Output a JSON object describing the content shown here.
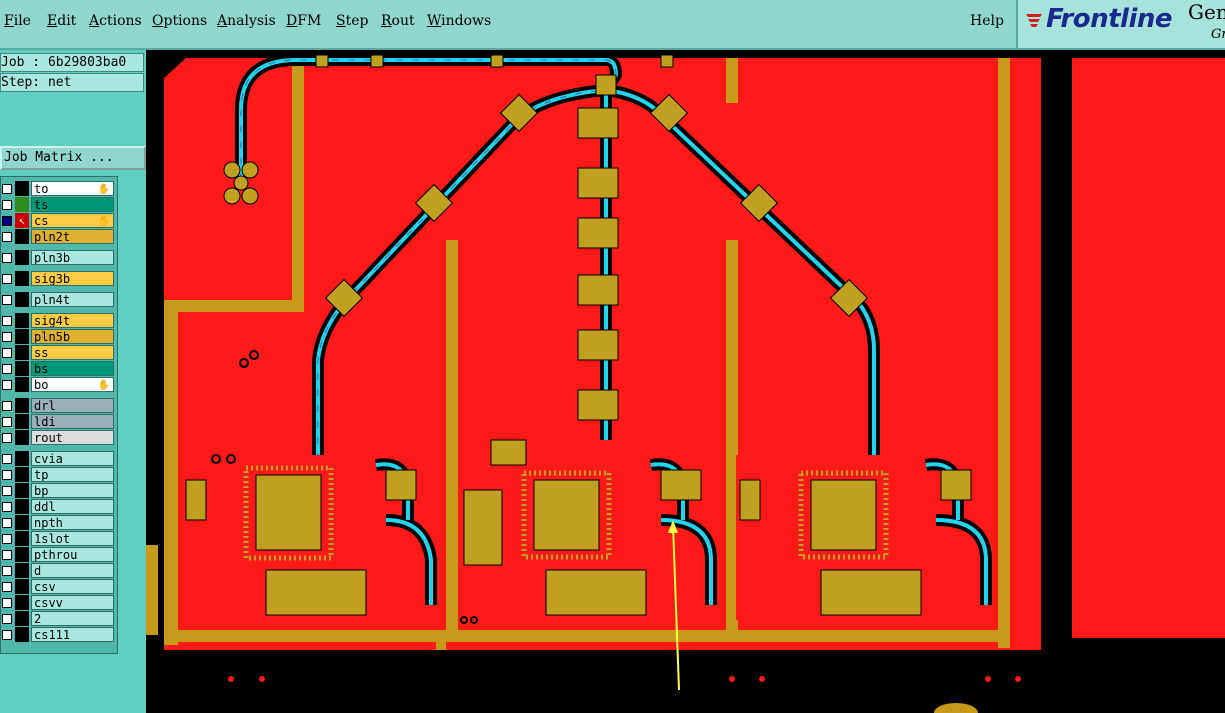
{
  "menubar": {
    "items": [
      {
        "label": "File",
        "u": "F",
        "rest": "ile"
      },
      {
        "label": "Edit",
        "u": "E",
        "rest": "dit"
      },
      {
        "label": "Actions",
        "u": "A",
        "rest": "ctions"
      },
      {
        "label": "Options",
        "u": "O",
        "rest": "ptions"
      },
      {
        "label": "Analysis",
        "u": "A",
        "rest": "nalysis"
      },
      {
        "label": "DFM",
        "u": "D",
        "rest": "FM"
      },
      {
        "label": "Step",
        "u": "S",
        "rest": "tep"
      },
      {
        "label": "Rout",
        "u": "R",
        "rest": "out"
      },
      {
        "label": "Windows",
        "u": "W",
        "rest": "indows"
      }
    ],
    "help": "Help"
  },
  "logo": {
    "brand": "Frontline",
    "product": "Gen",
    "sub": "Gr"
  },
  "job": {
    "job_label": "Job : 6b29803ba0",
    "step_label": "Step: net",
    "matrix_button": "Job Matrix ..."
  },
  "layers": [
    {
      "name": "to",
      "color": "#000000",
      "bg": "#ffffff",
      "checked": false,
      "icon": "hand"
    },
    {
      "name": "ts",
      "color": "#2e8b1e",
      "bg": "#009977",
      "checked": false,
      "icon": ""
    },
    {
      "name": "cs",
      "color": "#cc0000",
      "bg": "#ffcc44",
      "checked": true,
      "icon": "hand"
    },
    {
      "name": "pln2t",
      "color": "#000000",
      "bg": "#e0b030",
      "checked": false,
      "icon": ""
    },
    {
      "name": "pln3b",
      "color": "#000000",
      "bg": "#a8e8de",
      "checked": false,
      "icon": ""
    },
    {
      "name": "sig3b",
      "color": "#000000",
      "bg": "#ffcc44",
      "checked": false,
      "icon": ""
    },
    {
      "name": "pln4t",
      "color": "#000000",
      "bg": "#a8e8de",
      "checked": false,
      "icon": ""
    },
    {
      "name": "sig4t",
      "color": "#000000",
      "bg": "#ffcc44",
      "checked": false,
      "icon": ""
    },
    {
      "name": "pln5b",
      "color": "#000000",
      "bg": "#e0b030",
      "checked": false,
      "icon": ""
    },
    {
      "name": "ss",
      "color": "#000000",
      "bg": "#ffcc44",
      "checked": false,
      "icon": ""
    },
    {
      "name": "bs",
      "color": "#000000",
      "bg": "#009977",
      "checked": false,
      "icon": ""
    },
    {
      "name": "bo",
      "color": "#000000",
      "bg": "#ffffff",
      "checked": false,
      "icon": "hand"
    },
    {
      "name": "drl",
      "color": "#000000",
      "bg": "#9ab0b8",
      "checked": false,
      "icon": ""
    },
    {
      "name": "ldi",
      "color": "#000000",
      "bg": "#9ab0b8",
      "checked": false,
      "icon": ""
    },
    {
      "name": "rout",
      "color": "#000000",
      "bg": "#dcdcdc",
      "checked": false,
      "icon": ""
    },
    {
      "name": "cvia",
      "color": "#000000",
      "bg": "#a8e8de",
      "checked": false,
      "icon": ""
    },
    {
      "name": "tp",
      "color": "#000000",
      "bg": "#a8e8de",
      "checked": false,
      "icon": ""
    },
    {
      "name": "bp",
      "color": "#000000",
      "bg": "#a8e8de",
      "checked": false,
      "icon": ""
    },
    {
      "name": "ddl",
      "color": "#000000",
      "bg": "#a8e8de",
      "checked": false,
      "icon": ""
    },
    {
      "name": "npth",
      "color": "#000000",
      "bg": "#a8e8de",
      "checked": false,
      "icon": ""
    },
    {
      "name": "1slot",
      "color": "#000000",
      "bg": "#a8e8de",
      "checked": false,
      "icon": ""
    },
    {
      "name": "pthrou",
      "color": "#000000",
      "bg": "#a8e8de",
      "checked": false,
      "icon": ""
    },
    {
      "name": "d",
      "color": "#000000",
      "bg": "#a8e8de",
      "checked": false,
      "icon": ""
    },
    {
      "name": "csv",
      "color": "#000000",
      "bg": "#a8e8de",
      "checked": false,
      "icon": ""
    },
    {
      "name": "csvv",
      "color": "#000000",
      "bg": "#a8e8de",
      "checked": false,
      "icon": ""
    },
    {
      "name": "2",
      "color": "#000000",
      "bg": "#a8e8de",
      "checked": false,
      "icon": ""
    },
    {
      "name": "cs111",
      "color": "#000000",
      "bg": "#a8e8de",
      "checked": false,
      "icon": ""
    }
  ],
  "colors": {
    "board": "#ff1a1a",
    "copper": "#c89a1a",
    "trace": "#22d4f0",
    "pad": "#c0a020",
    "annotation": "#ffff44"
  }
}
